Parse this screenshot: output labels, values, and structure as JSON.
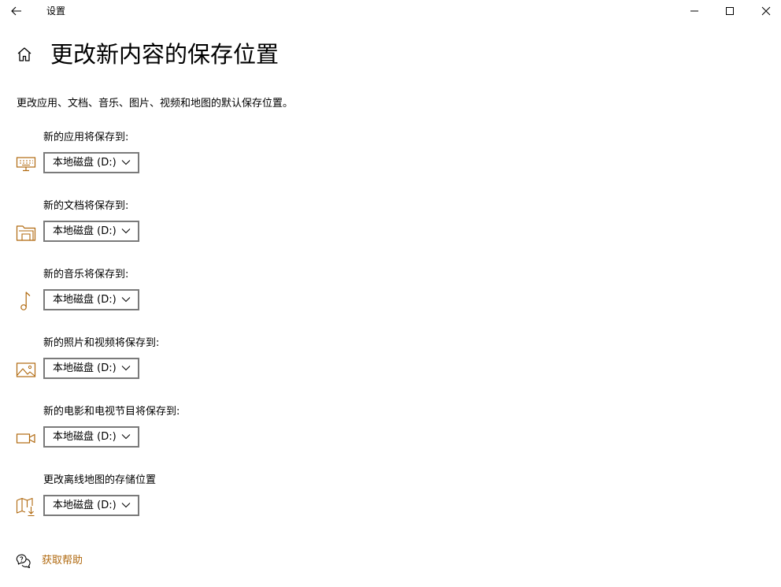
{
  "window": {
    "title": "设置"
  },
  "page": {
    "title": "更改新内容的保存位置",
    "description": "更改应用、文档、音乐、图片、视频和地图的默认保存位置。"
  },
  "rows": [
    {
      "label": "新的应用将保存到:",
      "value": "本地磁盘 (D:)",
      "icon": "monitor-icon"
    },
    {
      "label": "新的文档将保存到:",
      "value": "本地磁盘 (D:)",
      "icon": "folder-icon"
    },
    {
      "label": "新的音乐将保存到:",
      "value": "本地磁盘 (D:)",
      "icon": "music-note-icon"
    },
    {
      "label": "新的照片和视频将保存到:",
      "value": "本地磁盘 (D:)",
      "icon": "picture-icon"
    },
    {
      "label": "新的电影和电视节目将保存到:",
      "value": "本地磁盘 (D:)",
      "icon": "video-camera-icon"
    },
    {
      "label": "更改离线地图的存储位置",
      "value": "本地磁盘 (D:)",
      "icon": "map-download-icon"
    }
  ],
  "help": {
    "label": "获取帮助",
    "icon": "help-chat-icon"
  },
  "colors": {
    "accent": "#b0690f",
    "dropdown_border": "#7a7a7a"
  }
}
